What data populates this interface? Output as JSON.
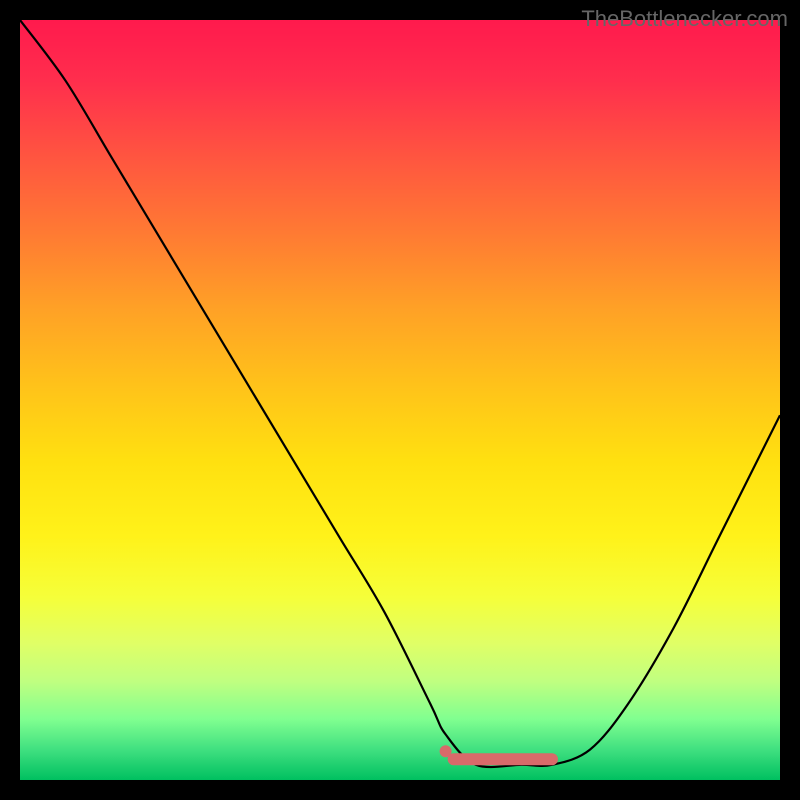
{
  "attribution": "TheBottlenecker.com",
  "chart_data": {
    "type": "line",
    "title": "",
    "xlabel": "",
    "ylabel": "",
    "xlim": [
      0,
      100
    ],
    "ylim": [
      0,
      100
    ],
    "series": [
      {
        "name": "curve",
        "x": [
          0,
          6,
          12,
          18,
          24,
          30,
          36,
          42,
          48,
          54,
          56,
          60,
          66,
          70,
          75,
          80,
          86,
          92,
          100
        ],
        "y": [
          100,
          92,
          82,
          72,
          62,
          52,
          42,
          32,
          22,
          10,
          6,
          2,
          2,
          2,
          4,
          10,
          20,
          32,
          48
        ]
      }
    ],
    "highlight": {
      "name": "optimal-range",
      "color": "#d86a6a",
      "x_start": 56,
      "x_end": 70,
      "y": 3
    },
    "background_gradient": {
      "top": "#ff1a4d",
      "mid": "#ffe010",
      "bottom": "#00c060"
    }
  }
}
